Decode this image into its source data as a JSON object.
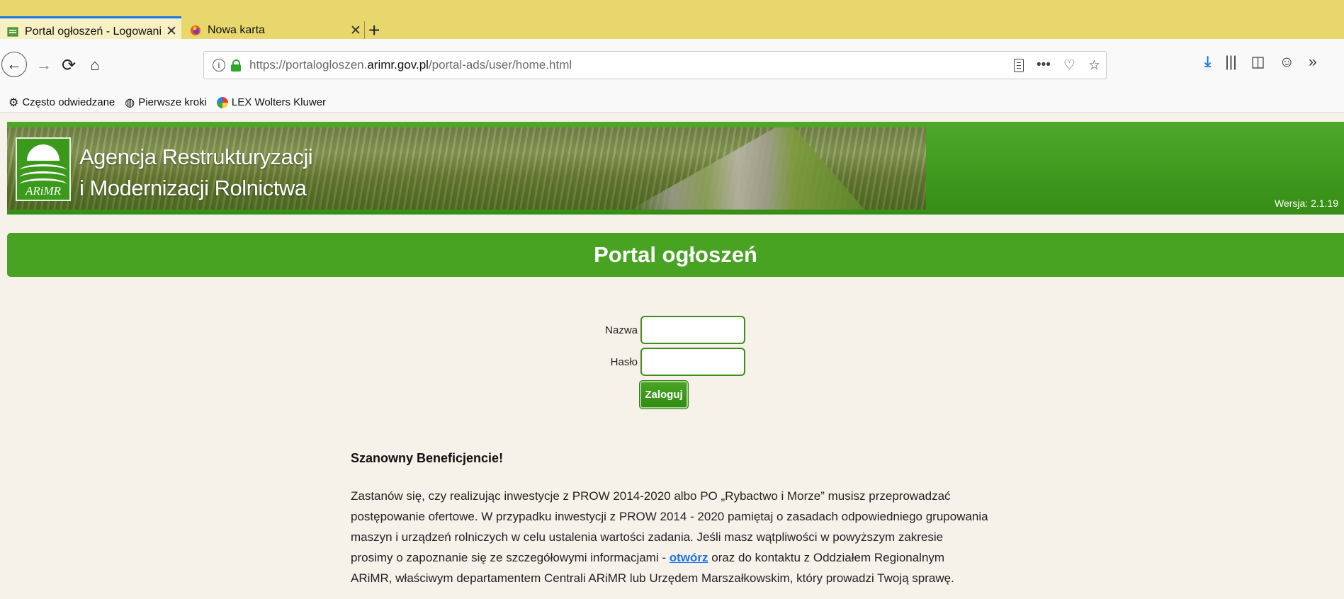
{
  "browser": {
    "tabs": [
      {
        "title": "Portal ogłoszeń - Logowanie",
        "close": "✕"
      },
      {
        "title": "Nowa karta",
        "close": "✕"
      }
    ],
    "new_tab": "+",
    "url_prefix": "https://portalogloszen.",
    "url_domain": "arimr.gov.pl",
    "url_path": "/portal-ads/user/home.html",
    "url_info": "i",
    "url_right_icons": {
      "more": "•••",
      "pocket": "♡",
      "star": "☆"
    },
    "nav_icons": {
      "back": "←",
      "forward": "→",
      "reload": "⟳",
      "home": "⌂"
    },
    "toolbar_icons": {
      "download": "⤓",
      "library": "|||",
      "sidebar": "◫",
      "account": "☺",
      "overflow": "»"
    },
    "bookmarks": [
      {
        "label": "Często odwiedzane",
        "icon": "gear-icon"
      },
      {
        "label": "Pierwsze kroki",
        "icon": "globe-icon"
      },
      {
        "label": "LEX Wolters Kluwer",
        "icon": "lex-icon"
      }
    ]
  },
  "header": {
    "logo_text": "ARiMR",
    "agency_line1": "Agencja Restrukturyzacji",
    "agency_line2": "i Modernizacji Rolnictwa",
    "version": "Wersja: 2.1.19"
  },
  "portal": {
    "title": "Portal ogłoszeń"
  },
  "login": {
    "name_label": "Nazwa",
    "name_value": "",
    "password_label": "Hasło",
    "password_value": "",
    "button": "Zaloguj"
  },
  "notice": {
    "heading": "Szanowny Beneficjencie!",
    "body_before": "Zastanów się, czy realizując inwestycje z PROW 2014-2020 albo PO „Rybactwo i Morze” musisz przeprowadzać postępowanie ofertowe. W przypadku inwestycji z PROW 2014 - 2020 pamiętaj o zasadach odpowiedniego grupowania maszyn i urządzeń rolniczych w celu ustalenia wartości zadania. Jeśli masz wątpliwości w powyższym zakresie prosimy o zapoznanie się ze szczegółowymi informacjami - ",
    "link": "otwórz",
    "body_after": " oraz do kontaktu z Oddziałem Regionalnym ARiMR, właściwym departamentem Centrali ARiMR lub Urzędem Marszałkowskim, który prowadzi Twoją sprawę."
  },
  "colors": {
    "header_green": "#3f9a1e",
    "portal_bar": "#48a322",
    "page_bg": "#f6f2ea",
    "tabbar": "#e8d76d",
    "link": "#1a73e8"
  }
}
